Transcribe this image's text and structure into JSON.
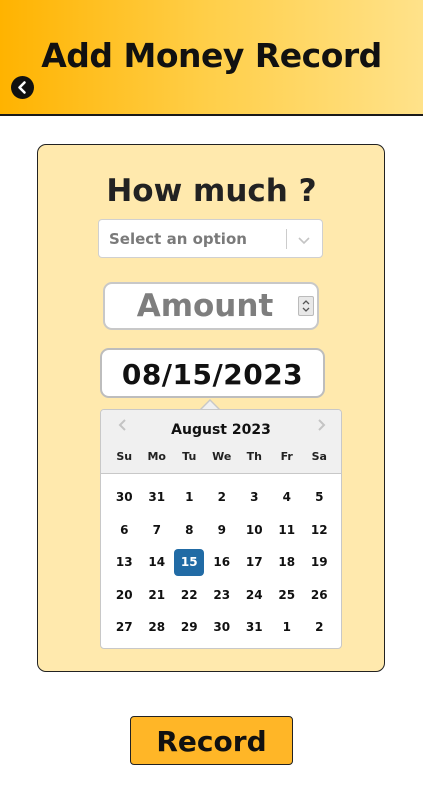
{
  "header": {
    "title": "Add Money Record",
    "back_icon": "chevron-left-icon"
  },
  "form": {
    "title": "How much ?",
    "select": {
      "value": "Select an option"
    },
    "amount": {
      "placeholder": "Amount"
    },
    "date": {
      "value": "08/15/2023"
    }
  },
  "calendar": {
    "month": "August 2023",
    "weekdays": [
      "Su",
      "Mo",
      "Tu",
      "We",
      "Th",
      "Fr",
      "Sa"
    ],
    "weeks": [
      [
        "30",
        "31",
        "1",
        "2",
        "3",
        "4",
        "5"
      ],
      [
        "6",
        "7",
        "8",
        "9",
        "10",
        "11",
        "12"
      ],
      [
        "13",
        "14",
        "15",
        "16",
        "17",
        "18",
        "19"
      ],
      [
        "20",
        "21",
        "22",
        "23",
        "24",
        "25",
        "26"
      ],
      [
        "27",
        "28",
        "29",
        "30",
        "31",
        "1",
        "2"
      ]
    ],
    "selected_day": "15",
    "accent_color": "#216ba5"
  },
  "actions": {
    "record_label": "Record",
    "record_color": "#ffb627"
  },
  "colors": {
    "header_start": "#ffb300",
    "header_end": "#ffe28a",
    "card_bg": "#ffe9ad"
  }
}
